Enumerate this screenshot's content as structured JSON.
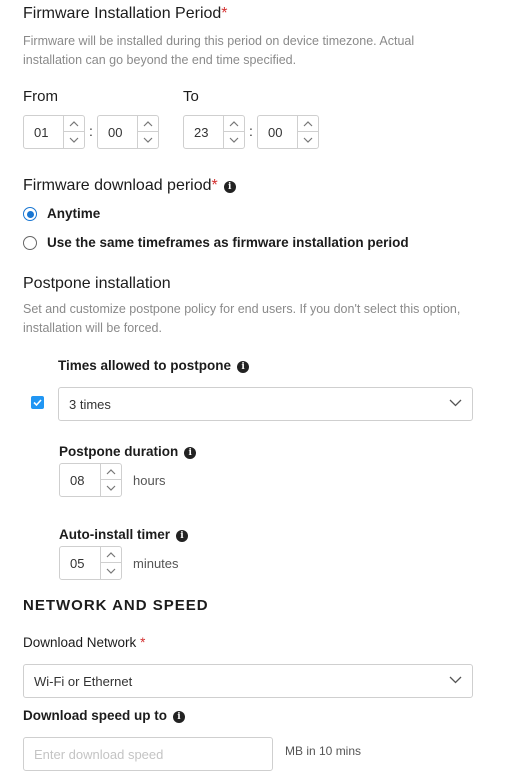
{
  "install_period": {
    "title": "Firmware Installation Period",
    "required_mark": "*",
    "description_line1": "Firmware will be installed during this period on device timezone. Actual",
    "description_line2": "installation can go beyond the end time specified.",
    "from_label": "From",
    "to_label": "To",
    "from_hour": "01",
    "from_minute": "00",
    "to_hour": "23",
    "to_minute": "00",
    "separator": ":"
  },
  "download_period": {
    "title": "Firmware download period",
    "required_mark": "*",
    "options": [
      {
        "label": "Anytime",
        "selected": true
      },
      {
        "label": "Use the same timeframes as firmware installation period",
        "selected": false
      }
    ]
  },
  "postpone": {
    "title": "Postpone installation",
    "description_line1": "Set and customize postpone policy for end users. If you don't select this option,",
    "description_line2": "installation will be forced.",
    "enabled": true,
    "times_label": "Times allowed to postpone",
    "times_value": "3 times",
    "duration_label": "Postpone duration",
    "duration_value": "08",
    "duration_unit": "hours",
    "timer_label": "Auto-install timer",
    "timer_value": "05",
    "timer_unit": "minutes"
  },
  "network": {
    "section_title": "NETWORK AND SPEED",
    "download_network_label": "Download Network",
    "required_mark": "*",
    "download_network_value": "Wi-Fi or Ethernet",
    "speed_label": "Download speed up to",
    "speed_placeholder": "Enter download speed",
    "speed_unit": "MB in 10 mins"
  },
  "colors": {
    "accent": "#1976d2",
    "checkbox": "#2196f3",
    "required": "#d32f2f"
  }
}
